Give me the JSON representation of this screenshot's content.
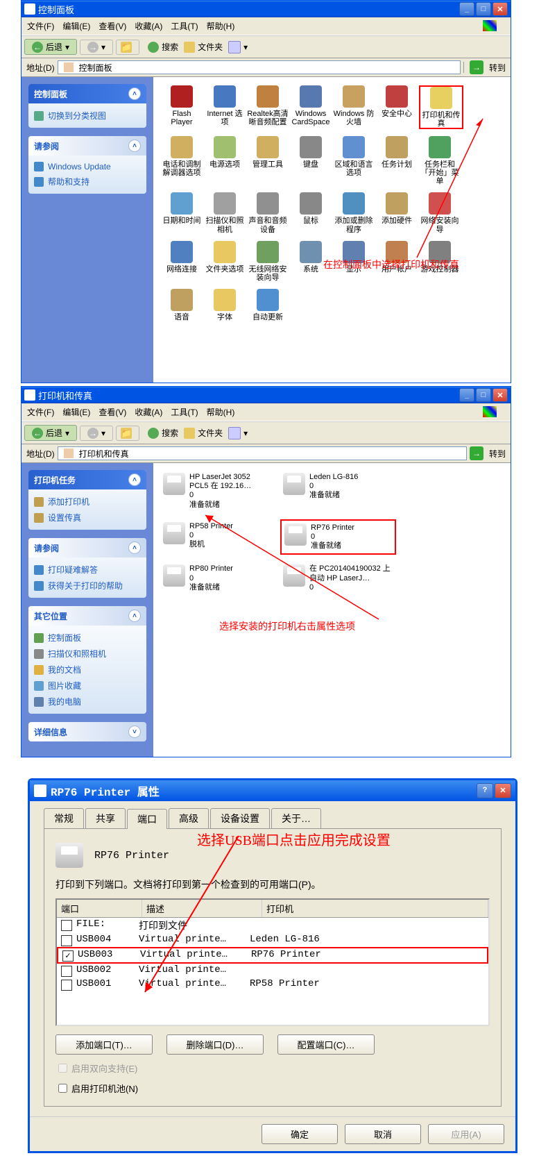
{
  "win1": {
    "title": "控制面板",
    "menus": [
      "文件(F)",
      "编辑(E)",
      "查看(V)",
      "收藏(A)",
      "工具(T)",
      "帮助(H)"
    ],
    "back": "后退",
    "search": "搜索",
    "folders": "文件夹",
    "addr_label": "地址(D)",
    "addr_value": "控制面板",
    "go": "转到",
    "panels": {
      "cp": {
        "title": "控制面板",
        "items": [
          {
            "label": "切换到分类视图",
            "color": "#5a8"
          }
        ]
      },
      "see": {
        "title": "请参阅",
        "items": [
          {
            "label": "Windows Update",
            "color": "#48c"
          },
          {
            "label": "帮助和支持",
            "color": "#48c"
          }
        ]
      }
    },
    "icons": [
      {
        "label": "Flash Player",
        "c": "#b02020"
      },
      {
        "label": "Internet 选项",
        "c": "#4878c0"
      },
      {
        "label": "Realtek高清晰音频配置",
        "c": "#c08040"
      },
      {
        "label": "Windows CardSpace",
        "c": "#5878b0"
      },
      {
        "label": "Windows 防火墙",
        "c": "#c8a060"
      },
      {
        "label": "安全中心",
        "c": "#c04040"
      },
      {
        "label": "打印机和传真",
        "c": "#e8d060",
        "hl": true
      },
      {
        "label": "电话和调制解调器选项",
        "c": "#d0b060"
      },
      {
        "label": "电源选项",
        "c": "#a0c070"
      },
      {
        "label": "管理工具",
        "c": "#d0b060"
      },
      {
        "label": "键盘",
        "c": "#888"
      },
      {
        "label": "区域和语言选项",
        "c": "#6090d0"
      },
      {
        "label": "任务计划",
        "c": "#c0a060"
      },
      {
        "label": "任务栏和「开始」菜单",
        "c": "#50a060"
      },
      {
        "label": "日期和时间",
        "c": "#60a0d0"
      },
      {
        "label": "扫描仪和照相机",
        "c": "#a0a0a0"
      },
      {
        "label": "声音和音频设备",
        "c": "#909090"
      },
      {
        "label": "鼠标",
        "c": "#888"
      },
      {
        "label": "添加或删除程序",
        "c": "#5090c0"
      },
      {
        "label": "添加硬件",
        "c": "#c0a060"
      },
      {
        "label": "网络安装向导",
        "c": "#d05050"
      },
      {
        "label": "网络连接",
        "c": "#5080c0"
      },
      {
        "label": "文件夹选项",
        "c": "#e8c860"
      },
      {
        "label": "无线网络安装向导",
        "c": "#70a060"
      },
      {
        "label": "系统",
        "c": "#7090b0"
      },
      {
        "label": "显示",
        "c": "#6080b0"
      },
      {
        "label": "用户帐户",
        "c": "#c08050"
      },
      {
        "label": "游戏控制器",
        "c": "#808080"
      },
      {
        "label": "语音",
        "c": "#c0a060"
      },
      {
        "label": "字体",
        "c": "#e8c860"
      },
      {
        "label": "自动更新",
        "c": "#5090d0"
      }
    ],
    "annotation": "在控制面板中选择打印机和传真"
  },
  "win2": {
    "title": "打印机和传真",
    "addr_value": "打印机和传真",
    "panels": {
      "tasks": {
        "title": "打印机任务",
        "items": [
          {
            "label": "添加打印机",
            "color": "#c0a050"
          },
          {
            "label": "设置传真",
            "color": "#c0a050"
          }
        ]
      },
      "see": {
        "title": "请参阅",
        "items": [
          {
            "label": "打印疑难解答",
            "color": "#48c"
          },
          {
            "label": "获得关于打印的帮助",
            "color": "#48c"
          }
        ]
      },
      "other": {
        "title": "其它位置",
        "items": [
          {
            "label": "控制面板",
            "color": "#60a050"
          },
          {
            "label": "扫描仪和照相机",
            "color": "#888"
          },
          {
            "label": "我的文档",
            "color": "#e0b040"
          },
          {
            "label": "图片收藏",
            "color": "#60a0d0"
          },
          {
            "label": "我的电脑",
            "color": "#6080b0"
          }
        ]
      },
      "detail": {
        "title": "详细信息"
      }
    },
    "printers": [
      {
        "name": "HP LaserJet 3052 PCL5 在 192.16…",
        "count": "0",
        "status": "准备就绪"
      },
      {
        "name": "Leden LG-816",
        "count": "0",
        "status": "准备就绪"
      },
      {
        "name": "RP58 Printer",
        "count": "0",
        "status": "脱机"
      },
      {
        "name": "RP76 Printer",
        "count": "0",
        "status": "准备就绪",
        "hl": true
      },
      {
        "name": "RP80 Printer",
        "count": "0",
        "status": "准备就绪"
      },
      {
        "name": "在 PC201404190032 上自动 HP LaserJ…",
        "count": "0",
        "status": ""
      }
    ],
    "annotation": "选择安装的打印机右击属性选项"
  },
  "dlg": {
    "title": "RP76 Printer 属性",
    "tabs": [
      "常规",
      "共享",
      "端口",
      "高级",
      "设备设置",
      "关于…"
    ],
    "active_tab": 2,
    "printer_name": "RP76 Printer",
    "instruction": "打印到下列端口。文档将打印到第一个检查到的可用端口(P)。",
    "cols": [
      "端口",
      "描述",
      "打印机"
    ],
    "rows": [
      {
        "chk": false,
        "port": "FILE:",
        "desc": "打印到文件",
        "pr": ""
      },
      {
        "chk": false,
        "port": "USB004",
        "desc": "Virtual printe…",
        "pr": "Leden LG-816"
      },
      {
        "chk": true,
        "port": "USB003",
        "desc": "Virtual printe…",
        "pr": "RP76 Printer",
        "hl": true
      },
      {
        "chk": false,
        "port": "USB002",
        "desc": "Virtual printe…",
        "pr": ""
      },
      {
        "chk": false,
        "port": "USB001",
        "desc": "Virtual printe…",
        "pr": "RP58 Printer"
      }
    ],
    "btn_add": "添加端口(T)…",
    "btn_del": "删除端口(D)…",
    "btn_cfg": "配置端口(C)…",
    "chk_bidir": "启用双向支持(E)",
    "chk_pool": "启用打印机池(N)",
    "ok": "确定",
    "cancel": "取消",
    "apply": "应用(A)",
    "annotation": "选择USB端口点击应用完成设置"
  }
}
